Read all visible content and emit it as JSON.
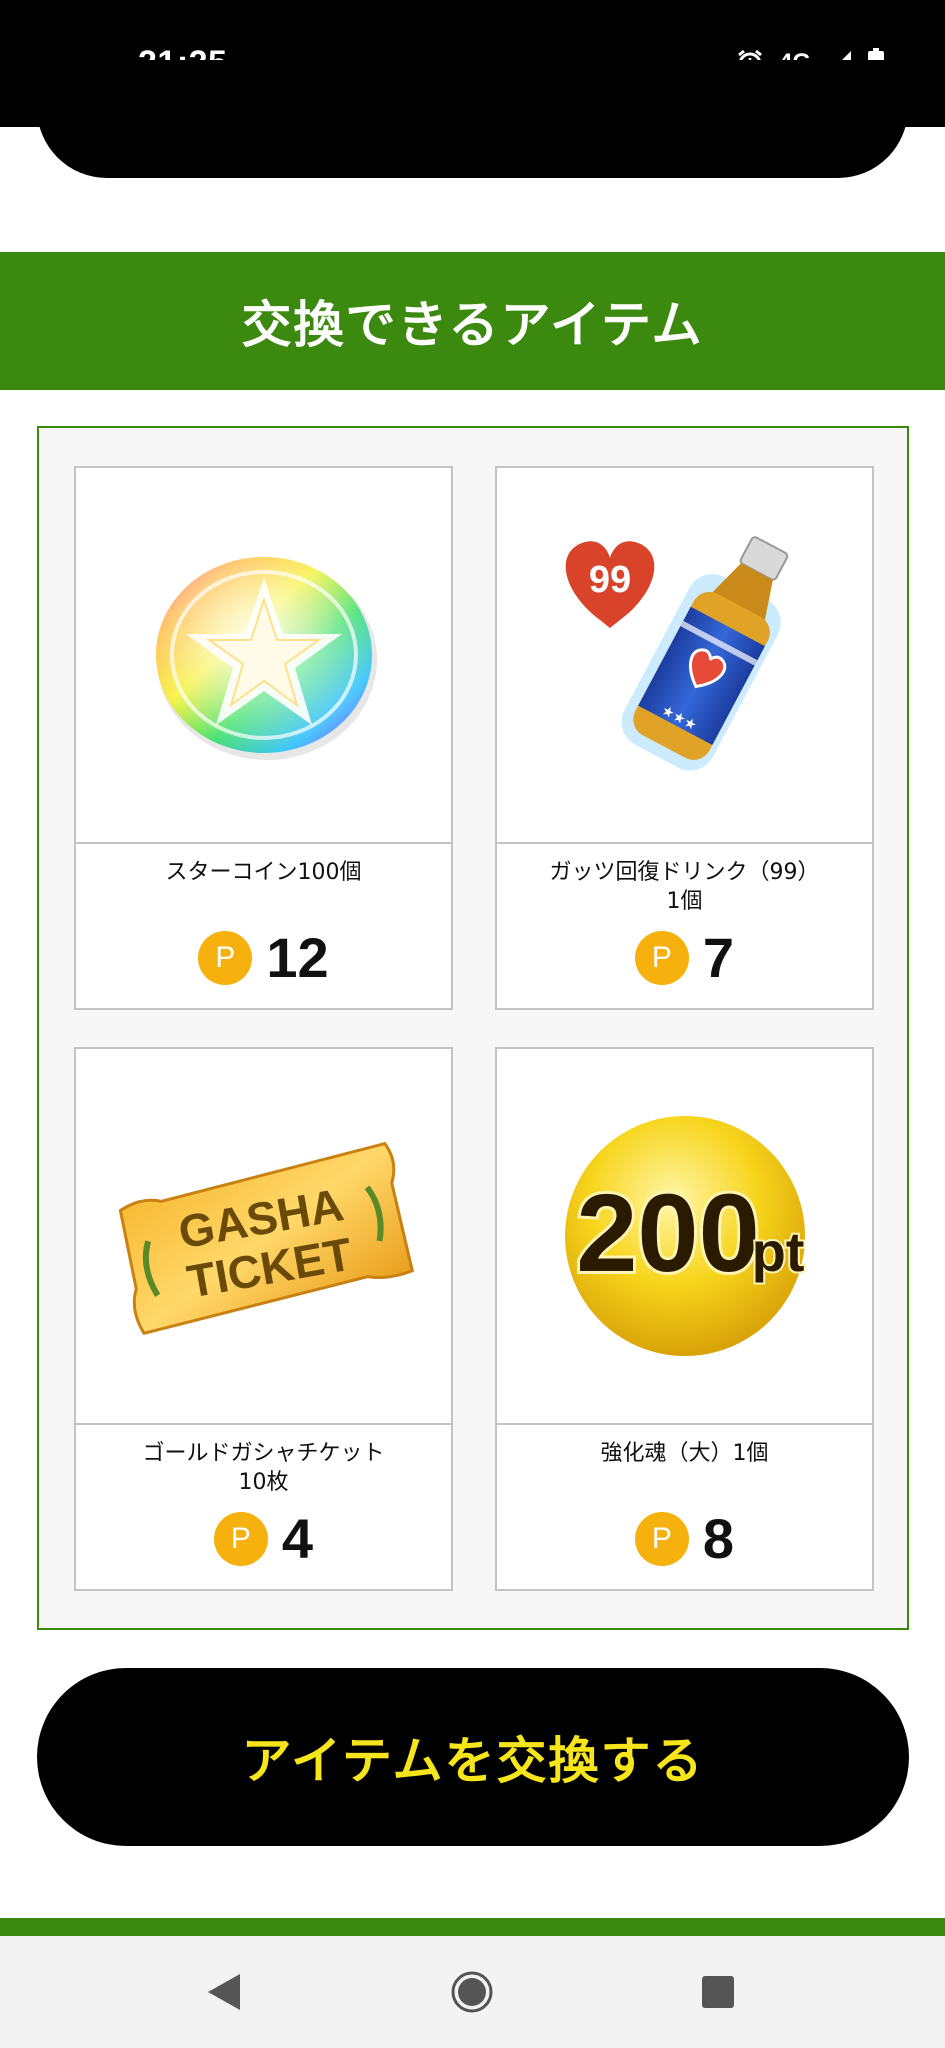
{
  "status": {
    "time": "21:25",
    "network": "4G",
    "icons": [
      "alarm-icon",
      "signal-icon",
      "battery-icon"
    ]
  },
  "section": {
    "title": "交換できるアイテム"
  },
  "items": [
    {
      "name_line1": "スターコイン100個",
      "name_line2": "",
      "price": "12",
      "badge": "P",
      "icon": "rainbow-star-coin-icon"
    },
    {
      "name_line1": "ガッツ回復ドリンク（99）",
      "name_line2": "1個",
      "price": "7",
      "badge": "P",
      "icon": "guts-drink-bottle-icon",
      "heart_number": "99"
    },
    {
      "name_line1": "ゴールドガシャチケット",
      "name_line2": "10枚",
      "price": "4",
      "badge": "P",
      "icon": "gold-gasha-ticket-icon",
      "ticket_text_1": "GASHA",
      "ticket_text_2": "TICKET"
    },
    {
      "name_line1": "強化魂（大）1個",
      "name_line2": "",
      "price": "8",
      "badge": "P",
      "icon": "200pt-gold-coin-icon",
      "coin_text_num": "200",
      "coin_text_unit": "pt"
    }
  ],
  "exchange_button": {
    "label": "アイテムを交換する"
  },
  "nav": {
    "back": "back-icon",
    "home": "home-icon",
    "recents": "recents-icon"
  },
  "colors": {
    "green": "#3b8a0f",
    "badge": "#f6b10e",
    "button_text": "#f5e51a"
  }
}
